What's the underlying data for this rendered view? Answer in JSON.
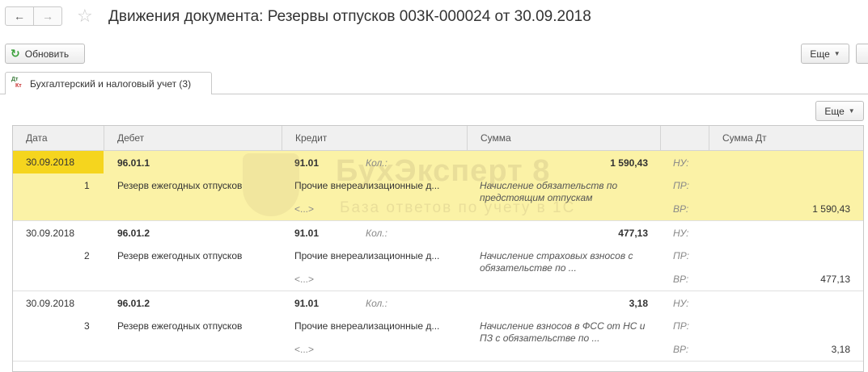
{
  "window": {
    "title": "Движения документа:  Резервы отпусков 003К-000024 от 30.09.2018",
    "nav_back": "←",
    "nav_forward": "→",
    "favorite_icon": "star-icon"
  },
  "toolbar": {
    "refresh_label": "Обновить",
    "more_label": "Еще",
    "more_caret": "▼"
  },
  "tab": {
    "icon_dt": "Дт",
    "icon_kt": "Кт",
    "label": "Бухгалтерский и налоговый учет (3)"
  },
  "table": {
    "more_label": "Еще",
    "headers": {
      "date": "Дата",
      "debit": "Дебет",
      "credit": "Кредит",
      "sum": "Сумма",
      "sum_dt": "Сумма Дт"
    },
    "rows": [
      {
        "date": "30.09.2018",
        "num": "1",
        "debit_account": "96.01.1",
        "debit_subconto": "Резерв ежегодных отпусков",
        "credit_account": "91.01",
        "qty_label": "Кол.:",
        "credit_subconto": "Прочие внереализационные д...",
        "credit_subconto2": "<...>",
        "sum": "1 590,43",
        "content": "Начисление обязательств по предстоящим отпускам",
        "nu_label": "НУ:",
        "pr_label": "ПР:",
        "vr_label": "ВР:",
        "vr_sum": "1 590,43",
        "selected": true
      },
      {
        "date": "30.09.2018",
        "num": "2",
        "debit_account": "96.01.2",
        "debit_subconto": "Резерв ежегодных отпусков",
        "credit_account": "91.01",
        "qty_label": "Кол.:",
        "credit_subconto": "Прочие внереализационные д...",
        "credit_subconto2": "<...>",
        "sum": "477,13",
        "content": "Начисление страховых взносов с обязательстве по ...",
        "nu_label": "НУ:",
        "pr_label": "ПР:",
        "vr_label": "ВР:",
        "vr_sum": "477,13",
        "selected": false
      },
      {
        "date": "30.09.2018",
        "num": "3",
        "debit_account": "96.01.2",
        "debit_subconto": "Резерв ежегодных отпусков",
        "credit_account": "91.01",
        "qty_label": "Кол.:",
        "credit_subconto": "Прочие внереализационные д...",
        "credit_subconto2": "<...>",
        "sum": "3,18",
        "content": "Начисление взносов в ФСС от НС и ПЗ с обязательстве по ...",
        "nu_label": "НУ:",
        "pr_label": "ПР:",
        "vr_label": "ВР:",
        "vr_sum": "3,18",
        "selected": false
      }
    ]
  },
  "watermark": {
    "name": "БухЭксперт 8",
    "subtitle": "База ответов по учету в 1С"
  },
  "colors": {
    "selected_row": "#fbf2a6",
    "selected_date": "#f5d51e",
    "header_bg": "#f0f0f0",
    "refresh_icon": "#3aa03a"
  }
}
